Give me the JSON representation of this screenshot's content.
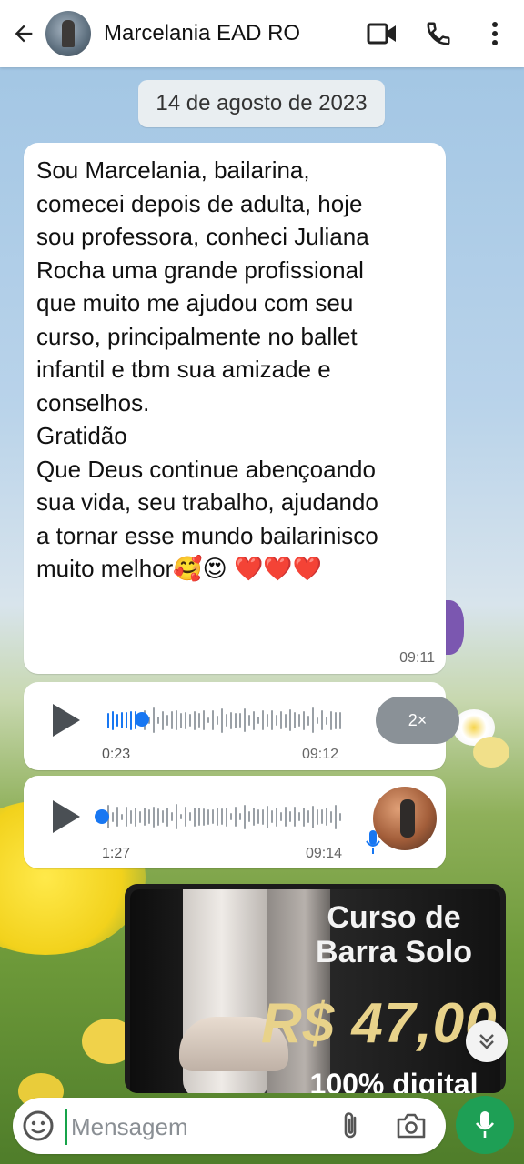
{
  "header": {
    "contact_name": "Marcelania EAD RO",
    "back_icon": "arrow-left-icon",
    "video_icon": "video-call-icon",
    "call_icon": "phone-icon",
    "menu_icon": "more-vertical-icon"
  },
  "date_separator": "14 de agosto de 2023",
  "messages": [
    {
      "type": "text",
      "text": "Sou Marcelania, bailarina,\ncomecei depois de adulta, hoje\nsou professora, conheci Juliana\nRocha uma grande profissional\nque muito me ajudou com seu\ncurso, principalmente no ballet\ninfantil e tbm sua amizade e\nconselhos.\nGratidão\nQue Deus continue abençoando\nsua vida, seu trabalho, ajudando\na tornar esse mundo bailarinisco\nmuito melhor🥰😍 ❤️❤️❤️",
      "time": "09:11"
    },
    {
      "type": "audio",
      "duration": "0:23",
      "time": "09:12",
      "speed": "2×",
      "progress": 0.15
    },
    {
      "type": "audio",
      "duration": "1:27",
      "time": "09:14",
      "progress": 0.0
    },
    {
      "type": "image",
      "title": "Curso de\nBarra Solo",
      "price": "R$ 47,00",
      "tag": "100% digital"
    }
  ],
  "composer": {
    "placeholder": "Mensagem",
    "emoji_icon": "sticker-icon",
    "attach_icon": "paperclip-icon",
    "camera_icon": "camera-icon",
    "mic_icon": "microphone-icon"
  },
  "colors": {
    "accent_green": "#1e9f55",
    "audio_dot": "#1877f2",
    "price_gold": "#e8d28a"
  }
}
